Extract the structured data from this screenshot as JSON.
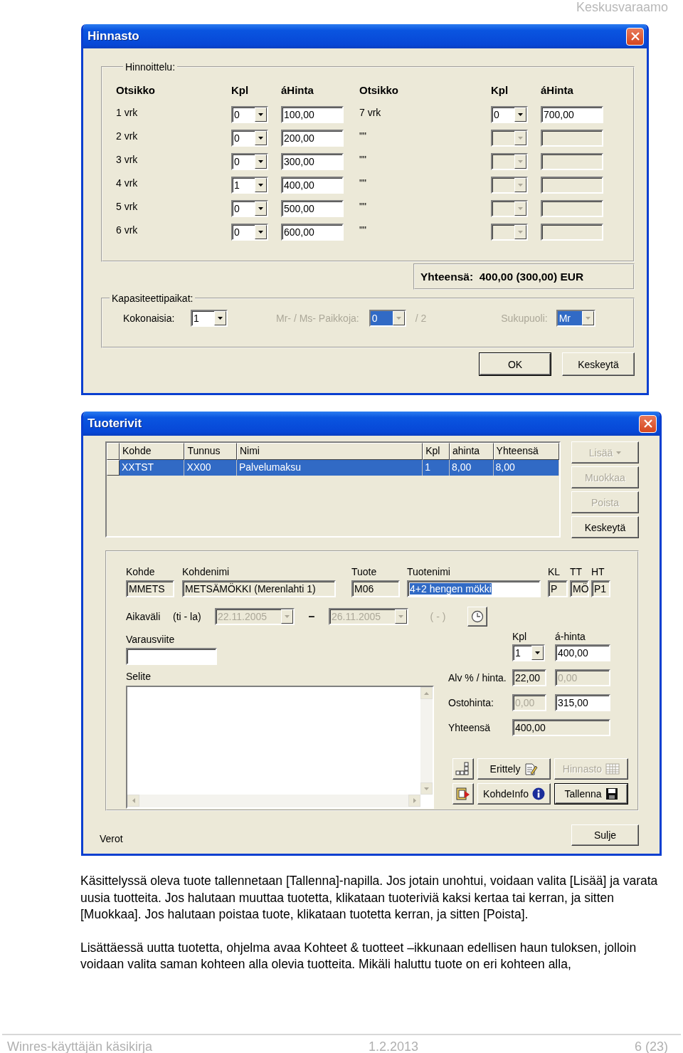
{
  "header": {
    "title": "Keskusvaraamo"
  },
  "pricing_dialog": {
    "title": "Hinnasto",
    "pricing": {
      "label": "Hinnoittelu:",
      "columns": [
        "Otsikko",
        "Kpl",
        "áHinta",
        "Otsikko",
        "Kpl",
        "áHinta"
      ],
      "left_rows": [
        {
          "label": "1 vrk",
          "quantity": "0",
          "price": "100,00"
        },
        {
          "label": "2 vrk",
          "quantity": "0",
          "price": "200,00"
        },
        {
          "label": "3 vrk",
          "quantity": "0",
          "price": "300,00"
        },
        {
          "label": "4 vrk",
          "quantity": "1",
          "price": "400,00"
        },
        {
          "label": "5 vrk",
          "quantity": "0",
          "price": "500,00"
        },
        {
          "label": "6 vrk",
          "quantity": "0",
          "price": "600,00"
        }
      ],
      "right_rows": [
        {
          "label": "7 vrk",
          "quantity": "0",
          "price": "700,00",
          "disabled": false
        },
        {
          "label": "\"\"",
          "disabled": true
        },
        {
          "label": "\"\"",
          "disabled": true
        },
        {
          "label": "\"\"",
          "disabled": true
        },
        {
          "label": "\"\"",
          "disabled": true
        },
        {
          "label": "\"\"",
          "disabled": true
        }
      ]
    },
    "total": "Yhteensä:  400,00 (300,00) EUR",
    "capacity": {
      "label": "Kapasiteettipaikat:",
      "total_label": "Kokonaisia:",
      "total_value": "1",
      "places_label": "Mr- / Ms- Paikkoja:",
      "places_value": "0",
      "places_suffix": "/ 2",
      "gender_label": "Sukupuoli:",
      "gender_value": "Mr",
      "disabled": true,
      "highlighted": true
    },
    "buttons": [
      {
        "label": "OK",
        "default": true
      },
      {
        "label": "Keskeytä",
        "default": false
      }
    ]
  },
  "rows_dialog": {
    "title": "Tuoterivit",
    "grid": {
      "columns": [
        "Kohde",
        "Tunnus",
        "Nimi",
        "Kpl",
        "ahinta",
        "Yhteensä"
      ],
      "rows": [
        {
          "cells": [
            "XXTST",
            "XX00",
            "Palvelumaksu",
            "1",
            "8,00",
            "8,00"
          ],
          "selected": true
        }
      ]
    },
    "side_buttons": [
      {
        "label": "Lisää",
        "disabled": true,
        "menu": true
      },
      {
        "label": "Muokkaa",
        "disabled": true,
        "menu": false
      },
      {
        "label": "Poista",
        "disabled": true,
        "menu": false
      },
      {
        "label": "Keskeytä",
        "disabled": false,
        "menu": false
      }
    ],
    "details": {
      "fields": [
        {
          "label": "Kohde",
          "value": "MMETS",
          "kind": "readonly",
          "highlighted": false
        },
        {
          "label": "Kohdenimi",
          "value": "METSÄMÖKKI (Merenlahti 1)",
          "kind": "readonly",
          "highlighted": false
        },
        {
          "label": "Tuote",
          "value": "M06",
          "kind": "readonly",
          "highlighted": false
        },
        {
          "label": "Tuotenimi",
          "value": "4+2 hengen mökki",
          "kind": "editable",
          "highlighted": true
        },
        {
          "label": "KL",
          "value": "P",
          "kind": "readonly",
          "highlighted": false
        },
        {
          "label": "TT",
          "value": "MÖ",
          "kind": "readonly",
          "highlighted": false
        },
        {
          "label": "HT",
          "value": "P1",
          "kind": "readonly",
          "highlighted": false
        }
      ],
      "period": {
        "label": "Aikaväli",
        "days": "(ti - la)",
        "from": "22.11.2005",
        "dash": "–",
        "to": "26.11.2005",
        "nights": "( - )",
        "disabled": true
      },
      "reference_label": "Varausviite",
      "note_label": "Selite",
      "quantity_label": "Kpl",
      "unit_price_label": "á-hinta",
      "quantity": "1",
      "unit_price": "400,00",
      "price_rows": [
        {
          "label": "Alv % / hinta.",
          "fields": [
            {
              "value": "22,00",
              "kind": "readonly"
            },
            {
              "value": "0,00",
              "kind": "disabled"
            }
          ]
        },
        {
          "label": "Ostohinta:",
          "fields": [
            {
              "value": "0,00",
              "kind": "disabled"
            },
            {
              "value": "315,00",
              "kind": "editable"
            }
          ]
        },
        {
          "label": "Yhteensä",
          "fields": [
            {
              "value": "400,00",
              "kind": "readonly"
            }
          ]
        }
      ],
      "action_buttons": [
        {
          "label": "Erittely",
          "disabled": false,
          "default": false
        },
        {
          "label": "Hinnasto",
          "disabled": true,
          "default": false
        },
        {
          "label": "KohdeInfo",
          "disabled": false,
          "default": false
        },
        {
          "label": "Tallenna",
          "disabled": false,
          "default": true
        }
      ]
    },
    "bottom_label": "Verot",
    "close_button": "Sulje"
  },
  "paragraphs": [
    "Käsittelyssä oleva tuote tallennetaan [Tallenna]-napilla. Jos jotain unohtui, voidaan valita [Lisää] ja varata uusia tuotteita. Jos halutaan muuttaa tuotetta, klikataan tuoteriviä kaksi kertaa tai kerran, ja sitten [Muokkaa]. Jos halutaan poistaa tuote, klikataan tuotetta kerran, ja sitten [Poista].",
    "Lisättäessä uutta tuotetta, ohjelma avaa Kohteet & tuotteet –ikkunaan edellisen haun tuloksen, jolloin voidaan valita saman kohteen alla olevia tuotteita. Mikäli haluttu tuote on eri kohteen alla,"
  ],
  "footer": {
    "left": "Winres-käyttäjän käsikirja",
    "center": "1.2.2013",
    "right": "6 (23)"
  }
}
